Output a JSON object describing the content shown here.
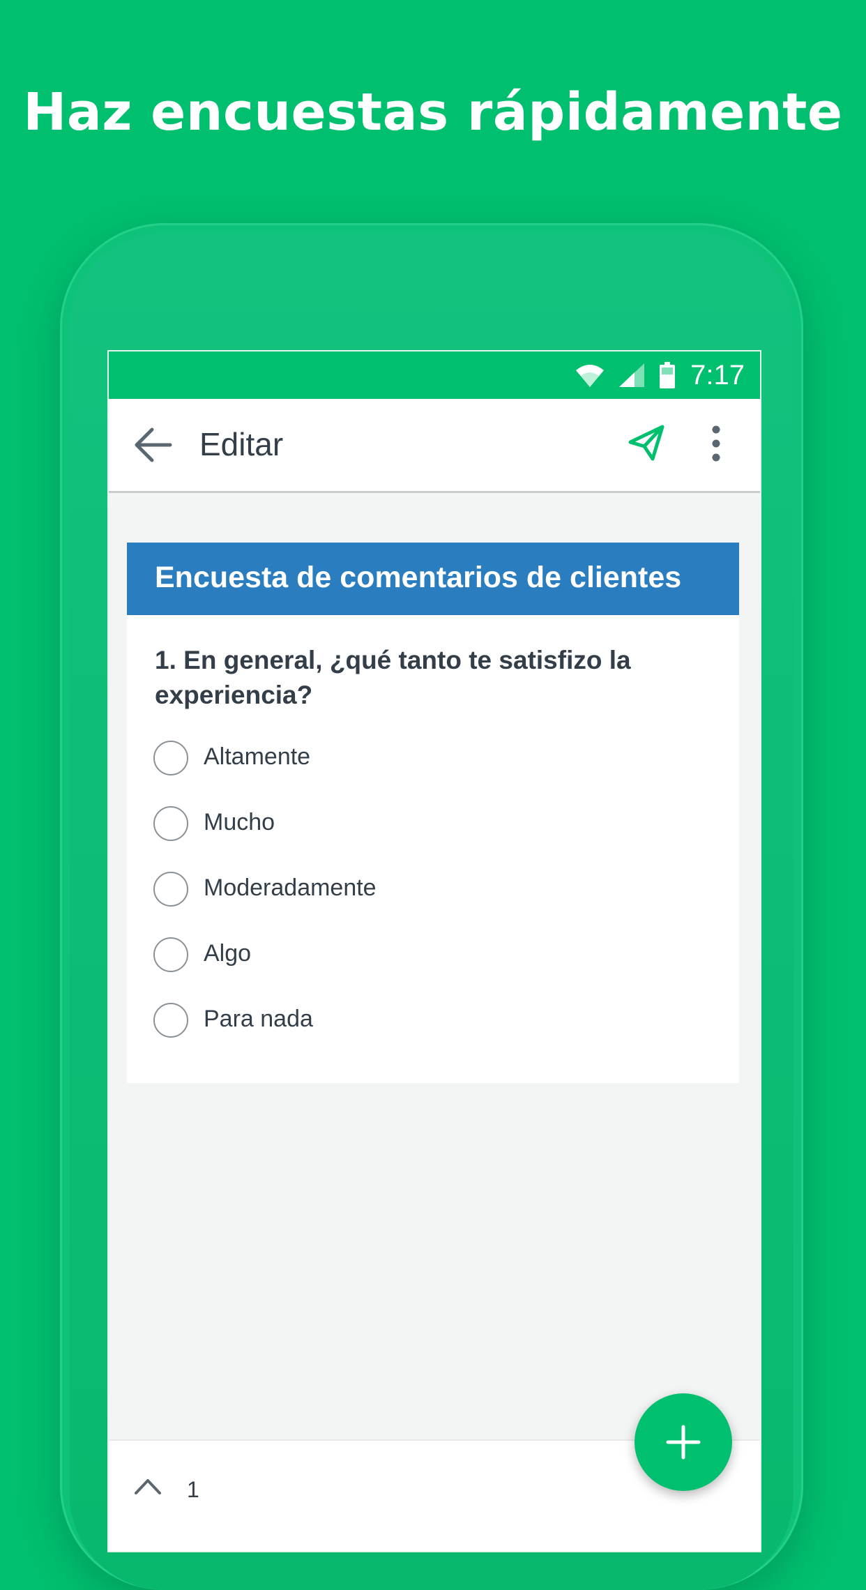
{
  "headline": "Haz encuestas rápidamente",
  "status_bar": {
    "time": "7:17",
    "icons": [
      "wifi-icon",
      "signal-icon",
      "battery-icon"
    ]
  },
  "app_bar": {
    "title": "Editar",
    "back_icon": "arrow-left-icon",
    "send_icon": "paper-plane-icon",
    "more_icon": "more-vertical-icon"
  },
  "survey": {
    "title": "Encuesta de comentarios de clientes",
    "question": "1. En general, ¿qué tanto te satisfizo la experiencia?",
    "options": [
      "Altamente",
      "Mucho",
      "Moderadamente",
      "Algo",
      "Para nada"
    ]
  },
  "bottom_bar": {
    "page_number": "1",
    "up_icon": "chevron-up-icon"
  },
  "fab_icon": "plus-icon",
  "colors": {
    "brand_green": "#00bf6f",
    "header_blue": "#2a7dbf",
    "text_dark": "#333e48",
    "screen_bg": "#f3f4f4"
  }
}
